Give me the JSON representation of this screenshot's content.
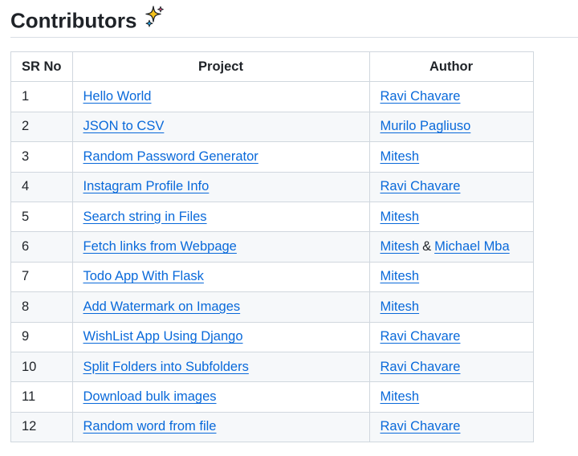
{
  "heading": {
    "title": "Contributors",
    "icon": "sparkles-icon",
    "icon_colors": [
      "#f4c21b",
      "#e2588a",
      "#26a6e6"
    ]
  },
  "table": {
    "headers": [
      "SR No",
      "Project",
      "Author"
    ],
    "rows": [
      {
        "no": "1",
        "project": "Hello World",
        "authors": [
          "Ravi Chavare"
        ]
      },
      {
        "no": "2",
        "project": "JSON to CSV",
        "authors": [
          "Murilo Pagliuso"
        ]
      },
      {
        "no": "3",
        "project": "Random Password Generator",
        "authors": [
          "Mitesh"
        ]
      },
      {
        "no": "4",
        "project": "Instagram Profile Info",
        "authors": [
          "Ravi Chavare"
        ]
      },
      {
        "no": "5",
        "project": "Search string in Files",
        "authors": [
          "Mitesh"
        ]
      },
      {
        "no": "6",
        "project": "Fetch links from Webpage",
        "authors": [
          "Mitesh",
          "Michael Mba"
        ]
      },
      {
        "no": "7",
        "project": "Todo App With Flask",
        "authors": [
          "Mitesh"
        ]
      },
      {
        "no": "8",
        "project": "Add Watermark on Images",
        "authors": [
          "Mitesh"
        ]
      },
      {
        "no": "9",
        "project": "WishList App Using Django",
        "authors": [
          "Ravi Chavare"
        ]
      },
      {
        "no": "10",
        "project": "Split Folders into Subfolders",
        "authors": [
          "Ravi Chavare"
        ]
      },
      {
        "no": "11",
        "project": "Download bulk images",
        "authors": [
          "Mitesh"
        ]
      },
      {
        "no": "12",
        "project": "Random word from file",
        "authors": [
          "Ravi Chavare"
        ]
      }
    ],
    "author_separator": "&"
  },
  "colors": {
    "link": "#0969da",
    "text": "#1f2328",
    "border": "#d0d7de",
    "stripe": "#f6f8fa"
  }
}
